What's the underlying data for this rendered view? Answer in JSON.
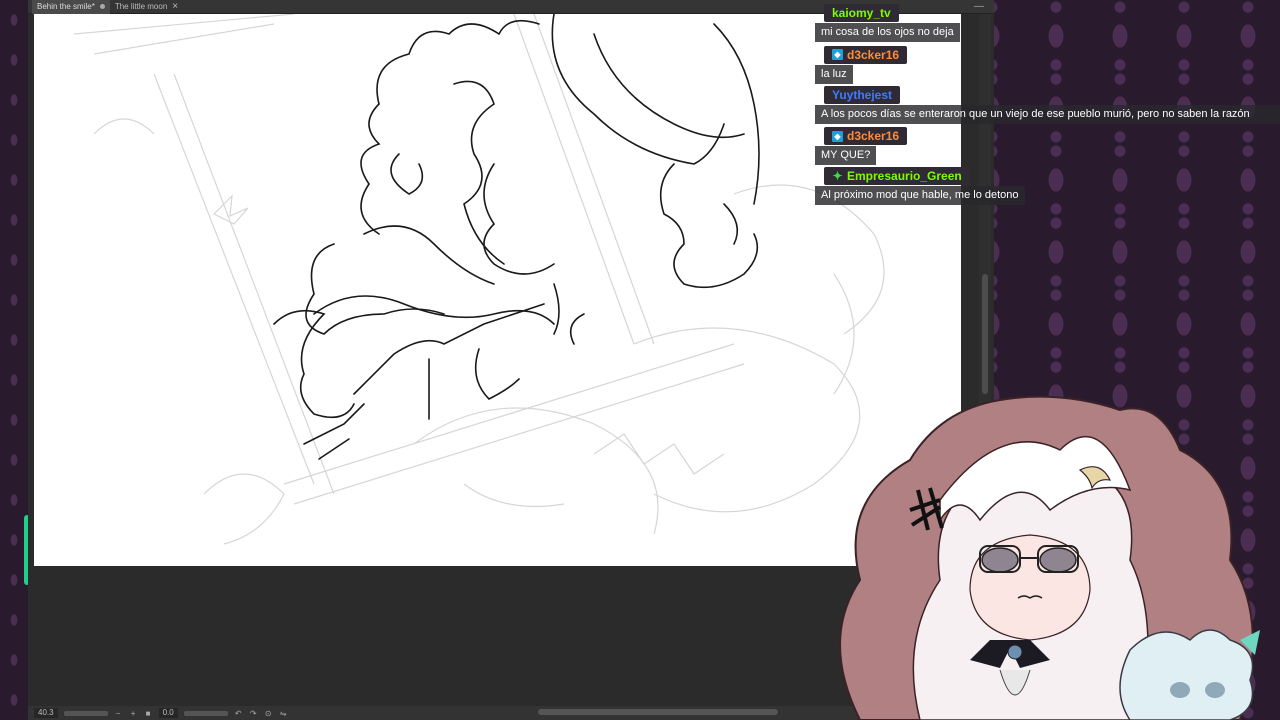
{
  "app": {
    "tabs": [
      {
        "label": "Behin the smile*",
        "active": true
      },
      {
        "label": "The little moon",
        "active": false
      }
    ],
    "status": {
      "zoom": "40.3",
      "rotation": "0.0"
    }
  },
  "chat": {
    "messages": [
      {
        "user": "kaiomy_tv",
        "color": "#7cfc00",
        "badge": "none",
        "text": "mi cosa de los ojos no deja"
      },
      {
        "user": "d3cker16",
        "color": "#ff8c3a",
        "badge": "prime",
        "text": "la luz"
      },
      {
        "user": "Yuythejest",
        "color": "#3f7bff",
        "badge": "none",
        "text": "A los pocos días se enteraron que un viejo de ese pueblo murió, pero no saben la razón"
      },
      {
        "user": "d3cker16",
        "color": "#ff8c3a",
        "badge": "prime",
        "text": "MY QUE?"
      },
      {
        "user": "Empresaurio_Green",
        "color": "#7cfc00",
        "badge": "sparkle",
        "text": "Al próximo mod que hable, me lo detono"
      }
    ]
  }
}
